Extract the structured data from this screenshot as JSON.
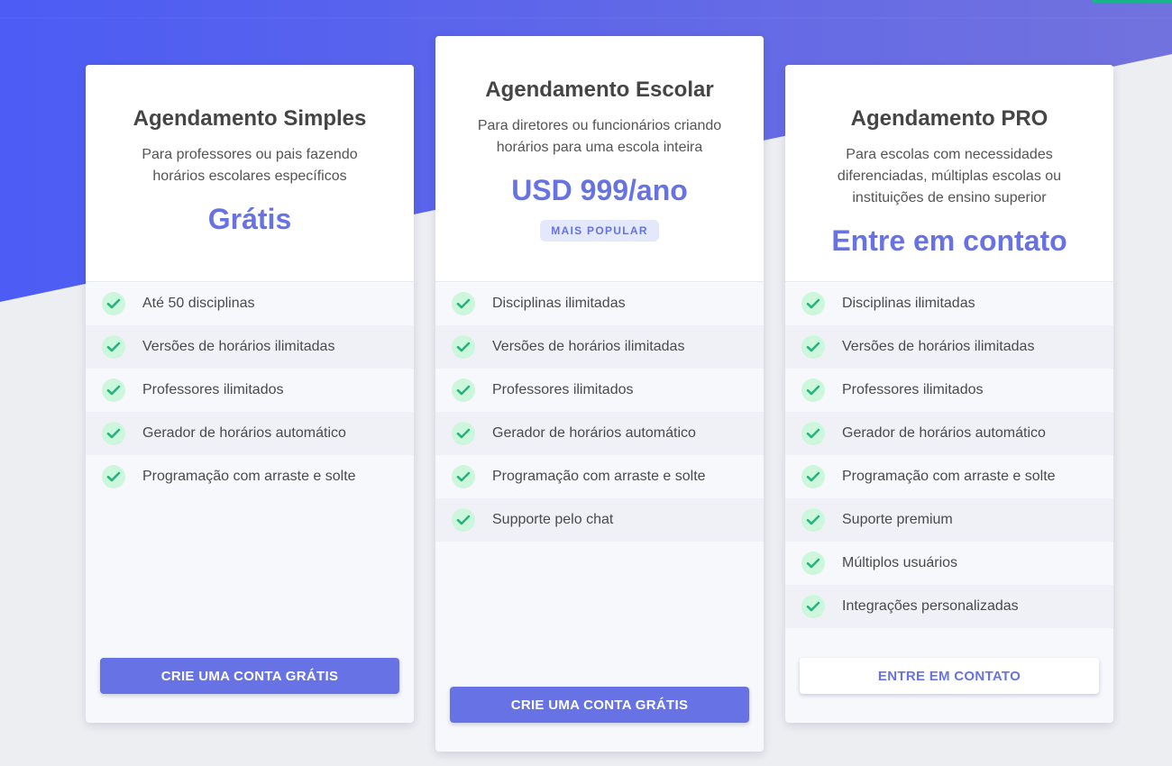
{
  "colors": {
    "accent": "#6772e5",
    "gradient_start": "#4c5cf4",
    "gradient_end": "#7272de",
    "page_background": "#edeef2",
    "check_green": "#24b47e",
    "check_bg": "#cdf7dc"
  },
  "plans": [
    {
      "title": "Agendamento Simples",
      "description": "Para professores ou pais fazendo horários escolares específicos",
      "price": "Grátis",
      "features": [
        "Até 50 disciplinas",
        "Versões de horários ilimitadas",
        "Professores ilimitados",
        "Gerador de horários automático",
        "Programação com arraste e solte"
      ],
      "cta": "CRIE UMA CONTA GRÁTIS"
    },
    {
      "title": "Agendamento Escolar",
      "description": "Para diretores ou funcionários criando horários para uma escola inteira",
      "price": "USD 999/ano",
      "badge": "MAIS POPULAR",
      "features": [
        "Disciplinas ilimitadas",
        "Versões de horários ilimitadas",
        "Professores ilimitados",
        "Gerador de horários automático",
        "Programação com arraste e solte",
        "Supporte pelo chat"
      ],
      "cta": "CRIE UMA CONTA GRÁTIS"
    },
    {
      "title": "Agendamento PRO",
      "description": "Para escolas com necessidades diferenciadas, múltiplas escolas ou instituições de ensino superior",
      "price": "Entre em contato",
      "features": [
        "Disciplinas ilimitadas",
        "Versões de horários ilimitadas",
        "Professores ilimitados",
        "Gerador de horários automático",
        "Programação com arraste e solte",
        "Suporte premium",
        "Múltiplos usuários",
        "Integrações personalizadas"
      ],
      "cta": "ENTRE EM CONTATO"
    }
  ]
}
